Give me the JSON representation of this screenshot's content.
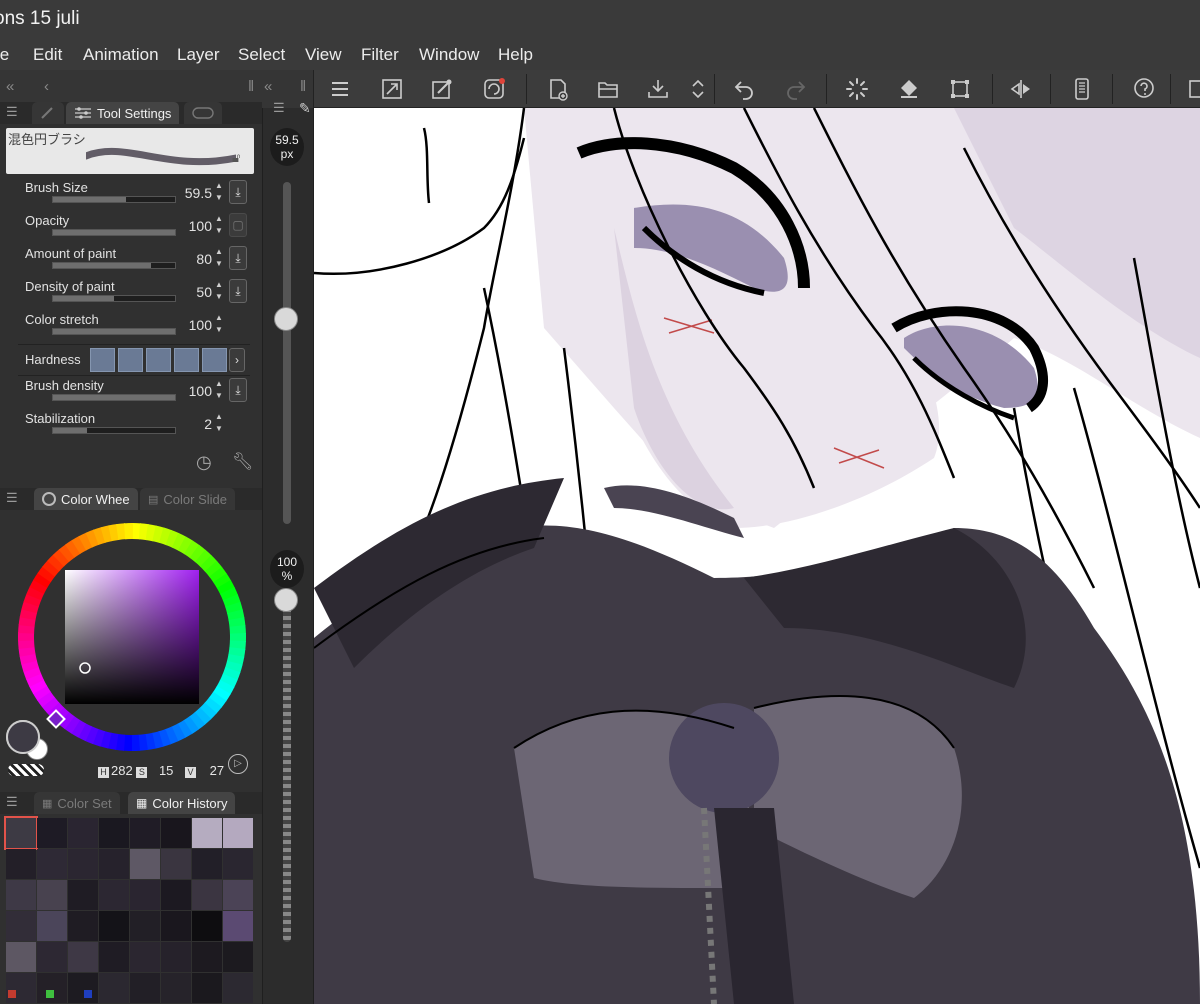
{
  "window": {
    "title": "ons 15 juli"
  },
  "menu": [
    "le",
    "Edit",
    "Animation",
    "Layer",
    "Select",
    "View",
    "Filter",
    "Window",
    "Help"
  ],
  "toolbar": {
    "icons": [
      "menu-icon",
      "fit-screen-icon",
      "eyedropper-transform-icon",
      "snap-icon",
      "new-canvas-icon",
      "open-folder-icon",
      "save-icon",
      "sort-arrows-icon",
      "undo-icon",
      "redo-icon",
      "loading-icon",
      "fill-icon",
      "crop-icon",
      "flip-icon",
      "device-icon",
      "help-icon"
    ]
  },
  "tool_panel": {
    "tab_label": "Tool Settings",
    "brush_name": "混色円ブラシ",
    "properties": [
      {
        "label": "Brush Size",
        "value": "59.5",
        "fill": 0.6,
        "action": "download-icon"
      },
      {
        "label": "Opacity",
        "value": "100",
        "fill": 1.0,
        "action": "checkbox-icon"
      },
      {
        "label": "Amount of paint",
        "value": "80",
        "fill": 0.8,
        "action": "download-icon"
      },
      {
        "label": "Density of paint",
        "value": "50",
        "fill": 0.5,
        "action": "download-icon"
      },
      {
        "label": "Color stretch",
        "value": "100",
        "fill": 1.0,
        "action": ""
      },
      {
        "label": "Brush density",
        "value": "100",
        "fill": 1.0,
        "action": "download-icon"
      },
      {
        "label": "Stabilization",
        "value": "2",
        "fill": 0.28,
        "action": ""
      }
    ],
    "hardness_label": "Hardness",
    "hardness_level": 4
  },
  "color_panel": {
    "tabs": [
      "Color Whee",
      "Color Slide"
    ],
    "hsv": {
      "h_label": "H",
      "h": "282",
      "s_label": "S",
      "s": "15",
      "v_label": "V",
      "v": "27"
    },
    "main_color": "#3d3a44",
    "sub_color": "#ffffff"
  },
  "history_panel": {
    "tabs": [
      "Color Set",
      "Color History"
    ],
    "swatches": [
      "#3d3a44",
      "#1e1b25",
      "#2a2531",
      "#1a1820",
      "#201c26",
      "#19161d",
      "#b5acc0",
      "#b4a9bf",
      "#231f28",
      "#2e2935",
      "#2b2631",
      "#26222c",
      "#5e5865",
      "#3a3540",
      "#221f28",
      "#2a2630",
      "#3e3946",
      "#48424f",
      "#1f1c24",
      "#2c2732",
      "#2a2530",
      "#1c1921",
      "#3b3541",
      "#4b4356",
      "#322d38",
      "#4b455a",
      "#1f1c23",
      "#141318",
      "#221f26",
      "#1a171e",
      "#0e0d10",
      "#5b4a72",
      "#5d5763",
      "#2d2833",
      "#3e3845",
      "#1f1c24",
      "#2b2630",
      "#26222b",
      "#1d1a20",
      "#1c1a1f",
      "#2d2933",
      "#242027",
      "#1d1b21",
      "#2b2830",
      "#221f26",
      "#26232a",
      "#1b191e",
      "#2c2931"
    ],
    "indicator_colors": [
      "#c33b2f",
      "#3fbf3f",
      "#1f3fbf"
    ]
  },
  "size_badge": {
    "value": "59.5",
    "unit": "px"
  },
  "opacity_badge": {
    "value": "100",
    "unit": "%"
  },
  "brush_size_slider": 0.6,
  "opacity_slider": 1.0
}
